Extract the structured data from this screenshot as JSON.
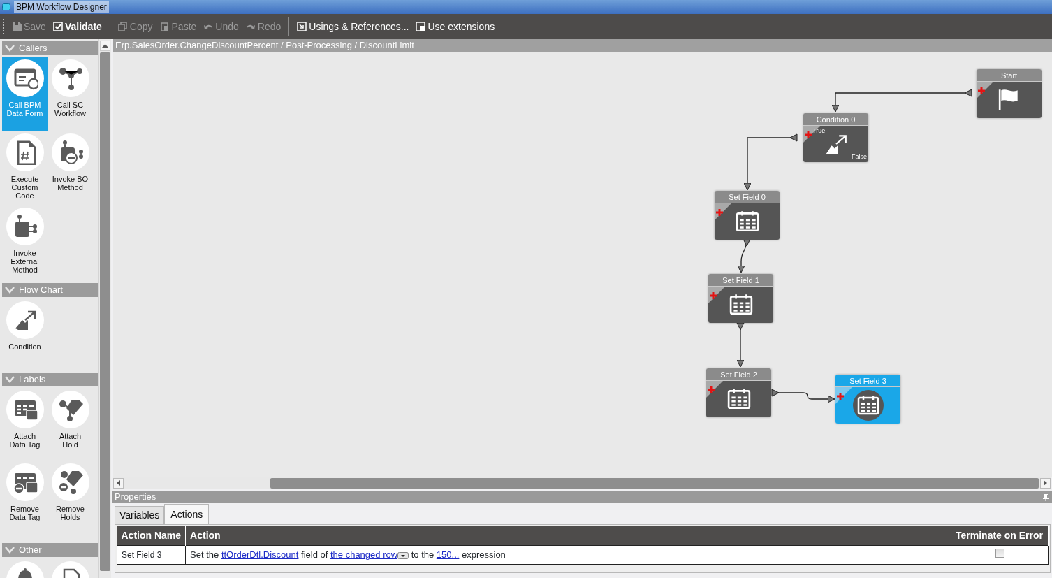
{
  "window": {
    "title": "BPM Workflow Designer"
  },
  "toolbar": [
    {
      "label": "Save",
      "kind": "save",
      "disabled": true
    },
    {
      "label": "Validate",
      "kind": "validate",
      "disabled": false
    },
    {
      "label": "Copy",
      "kind": "copy",
      "disabled": true
    },
    {
      "label": "Paste",
      "kind": "paste",
      "disabled": true
    },
    {
      "label": "Undo",
      "kind": "undo",
      "disabled": true
    },
    {
      "label": "Redo",
      "kind": "redo",
      "disabled": true
    },
    {
      "label": "Usings & References...",
      "kind": "usings",
      "disabled": false
    },
    {
      "label": "Use extensions",
      "kind": "extensions",
      "disabled": false
    }
  ],
  "palette": [
    {
      "title": "Callers",
      "items": [
        {
          "label": "Call BPM Data Form",
          "kind": "form",
          "selected": true
        },
        {
          "label": "Call SC Workflow",
          "kind": "network",
          "selected": false
        },
        {
          "label": "Execute Custom Code",
          "kind": "code",
          "selected": false
        },
        {
          "label": "Invoke BO Method",
          "kind": "bo",
          "selected": false
        },
        {
          "label": "Invoke External Method",
          "kind": "external",
          "selected": false
        }
      ]
    },
    {
      "title": "Flow Chart",
      "items": [
        {
          "label": "Condition",
          "kind": "condition",
          "selected": false
        }
      ]
    },
    {
      "title": "Labels",
      "items": [
        {
          "label": "Attach Data Tag",
          "kind": "datatag",
          "selected": false
        },
        {
          "label": "Attach Hold",
          "kind": "hold",
          "selected": false
        },
        {
          "label": "Remove Data Tag",
          "kind": "removedatatag",
          "selected": false
        },
        {
          "label": "Remove Holds",
          "kind": "removehold",
          "selected": false
        }
      ]
    },
    {
      "title": "Other",
      "items": [
        {
          "kind": "bell",
          "selected": false
        },
        {
          "kind": "docremove",
          "selected": false
        }
      ]
    }
  ],
  "breadcrumb": "Erp.SalesOrder.ChangeDiscountPercent / Post-Processing / DiscountLimit",
  "nodes": [
    {
      "title": "Start",
      "kind": "start",
      "selected": false
    },
    {
      "title": "Condition 0",
      "kind": "condition",
      "selected": false,
      "true_label": "True",
      "false_label": "False"
    },
    {
      "title": "Set Field 0",
      "kind": "setfield",
      "selected": false
    },
    {
      "title": "Set Field 1",
      "kind": "setfield",
      "selected": false
    },
    {
      "title": "Set Field 2",
      "kind": "setfield",
      "selected": false
    },
    {
      "title": "Set Field 3",
      "kind": "setfield",
      "selected": true
    }
  ],
  "properties": {
    "title": "Properties",
    "tabs": [
      {
        "label": "Variables",
        "selected": false
      },
      {
        "label": "Actions",
        "selected": true
      }
    ],
    "columns": [
      "Action Name",
      "Action",
      "Terminate on Error"
    ],
    "rows": [
      {
        "name": "Set Field 3",
        "terminate_on_error": false,
        "action": [
          {
            "kind": "text",
            "text": "Set the "
          },
          {
            "kind": "link",
            "text": "ttOrderDtl.Discount"
          },
          {
            "kind": "text",
            "text": " field of "
          },
          {
            "kind": "link",
            "text": "the changed row"
          },
          {
            "kind": "dropdown"
          },
          {
            "kind": "text",
            "text": " to the "
          },
          {
            "kind": "link",
            "text": "150..."
          },
          {
            "kind": "text",
            "text": " expression"
          }
        ]
      }
    ]
  }
}
